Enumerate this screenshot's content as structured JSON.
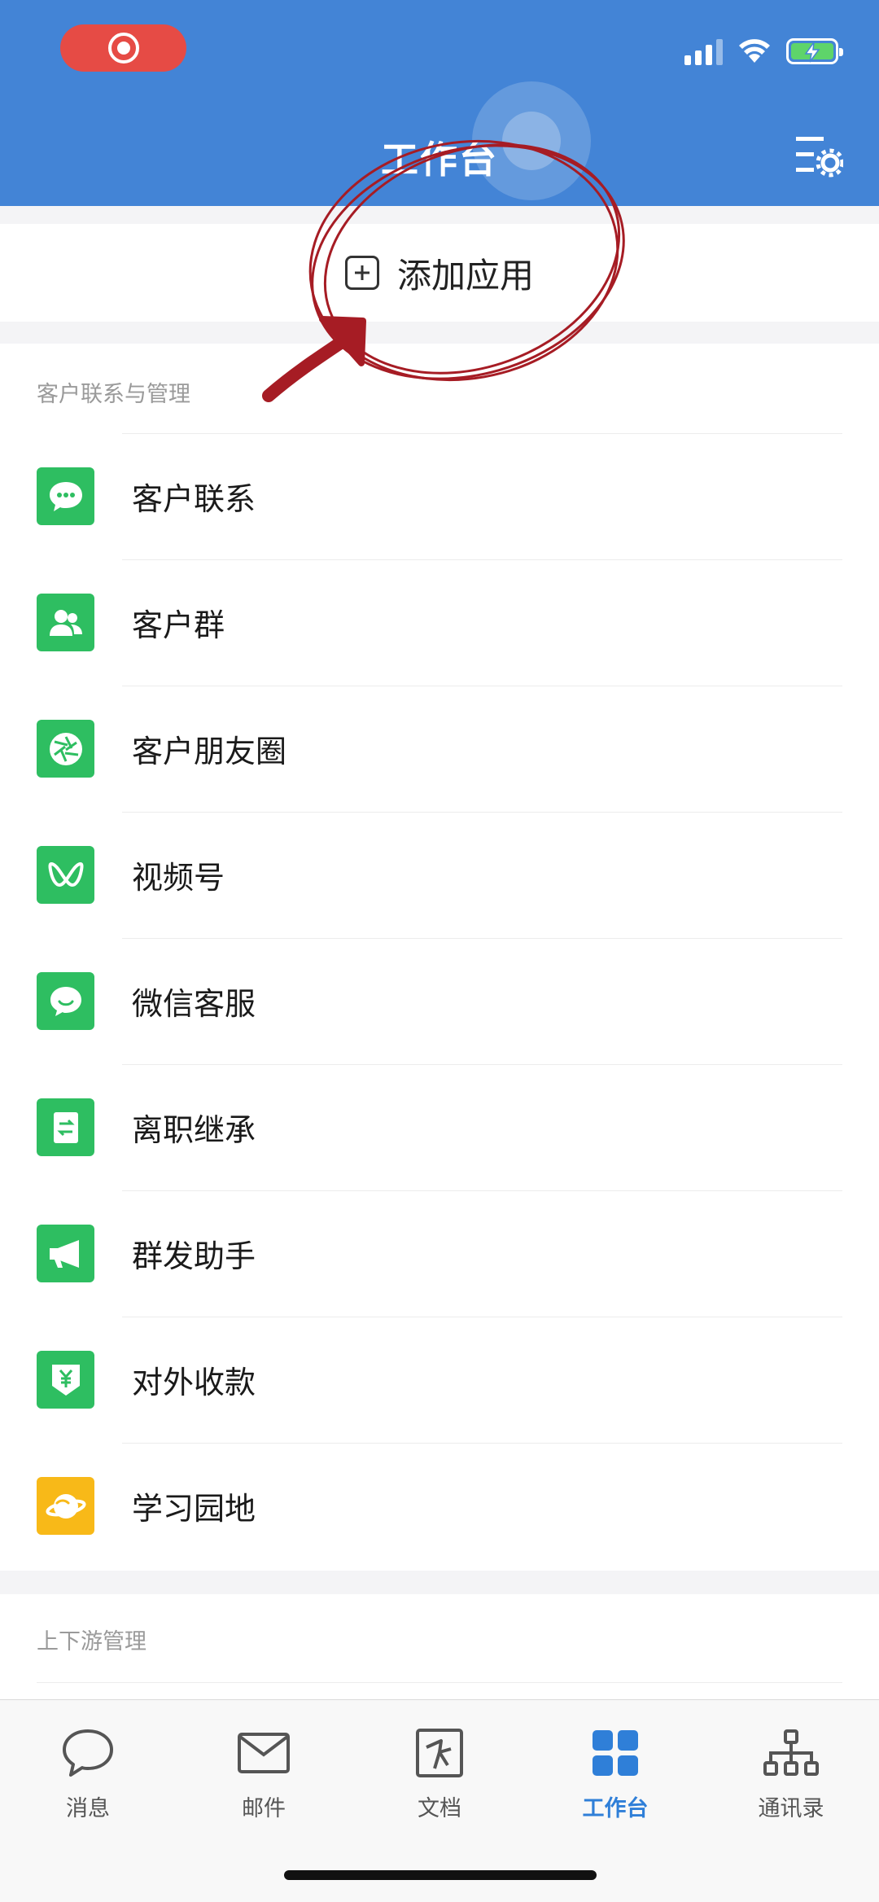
{
  "header": {
    "title": "工作台",
    "settings_icon": "list-settings-icon",
    "background_color": "#4384d6"
  },
  "status_bar": {
    "recording_icon": "screen-record-icon",
    "signal_icon": "cellular-signal-icon",
    "wifi_icon": "wifi-icon",
    "battery_icon": "battery-charging-icon"
  },
  "add_app": {
    "label": "添加应用",
    "icon": "plus-square-icon"
  },
  "section_customer": {
    "title": "客户联系与管理",
    "items": [
      {
        "label": "客户联系",
        "icon": "chat-bubble-icon",
        "color": "#2ebe61"
      },
      {
        "label": "客户群",
        "icon": "group-users-icon",
        "color": "#2ebe61"
      },
      {
        "label": "客户朋友圈",
        "icon": "aperture-icon",
        "color": "#2ebe61"
      },
      {
        "label": "视频号",
        "icon": "channels-butterfly-icon",
        "color": "#2ebe61"
      },
      {
        "label": "微信客服",
        "icon": "service-chat-icon",
        "color": "#2ebe61"
      },
      {
        "label": "离职继承",
        "icon": "transfer-document-icon",
        "color": "#2ebe61"
      },
      {
        "label": "群发助手",
        "icon": "megaphone-icon",
        "color": "#2ebe61"
      },
      {
        "label": "对外收款",
        "icon": "yuan-shield-icon",
        "color": "#2ebe61"
      },
      {
        "label": "学习园地",
        "icon": "planet-icon",
        "color": "#f8b918"
      }
    ]
  },
  "section_upstream": {
    "title": "上下游管理"
  },
  "tabbar": {
    "active_color": "#2f7fd8",
    "tabs": [
      {
        "label": "消息",
        "icon": "message-icon",
        "active": false
      },
      {
        "label": "邮件",
        "icon": "mail-icon",
        "active": false
      },
      {
        "label": "文档",
        "icon": "document-icon",
        "active": false
      },
      {
        "label": "工作台",
        "icon": "workbench-grid-icon",
        "active": true
      },
      {
        "label": "通讯录",
        "icon": "org-chart-icon",
        "active": false
      }
    ]
  }
}
